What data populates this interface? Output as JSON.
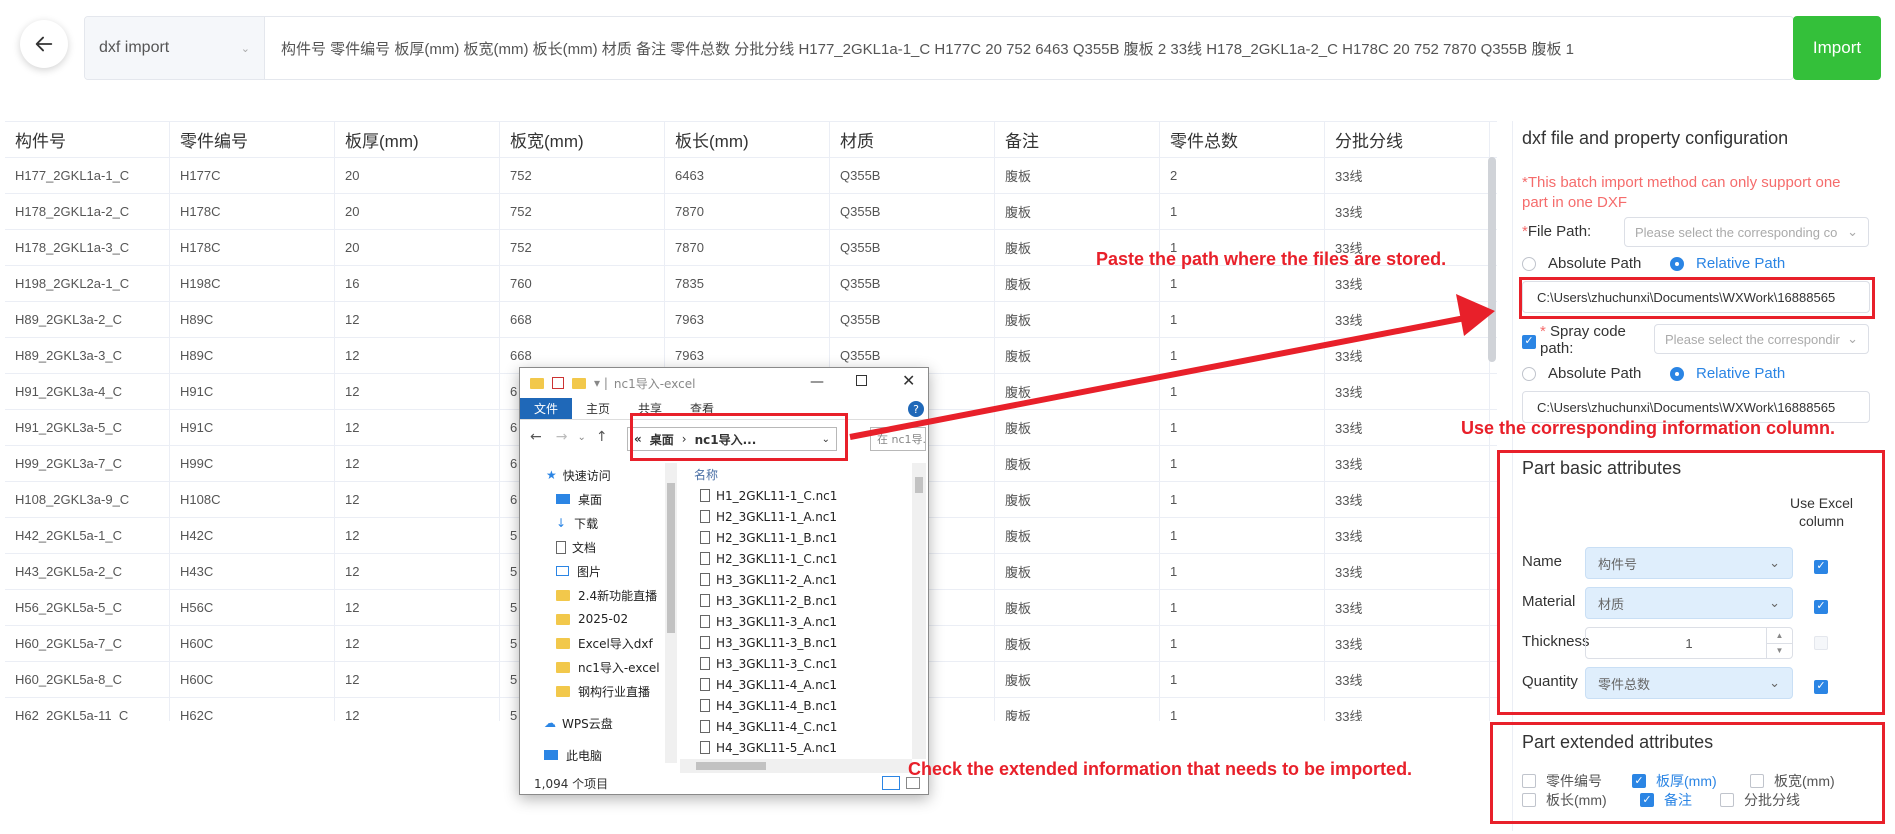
{
  "topbar": {
    "type_value": "dxf import",
    "paste_text": "构件号   零件编号  板厚(mm) 板宽(mm) 板长(mm) 材质  备注  零件总数   分批分线  H177_2GKL1a-1_C    H177C     20    752  6463        Q355B      腹板 2      33线  H178_2GKL1a-2_C   H178C     20    752  7870        Q355B      腹板 1",
    "import_label": "Import"
  },
  "table": {
    "headers": [
      "构件号",
      "零件编号",
      "板厚(mm)",
      "板宽(mm)",
      "板长(mm)",
      "材质",
      "备注",
      "零件总数",
      "分批分线"
    ],
    "rows": [
      [
        "H177_2GKL1a-1_C",
        "H177C",
        "20",
        "752",
        "6463",
        "Q355B",
        "腹板",
        "2",
        "33线"
      ],
      [
        "H178_2GKL1a-2_C",
        "H178C",
        "20",
        "752",
        "7870",
        "Q355B",
        "腹板",
        "1",
        "33线"
      ],
      [
        "H178_2GKL1a-3_C",
        "H178C",
        "20",
        "752",
        "7870",
        "Q355B",
        "腹板",
        "1",
        "33线"
      ],
      [
        "H198_2GKL2a-1_C",
        "H198C",
        "16",
        "760",
        "7835",
        "Q355B",
        "腹板",
        "1",
        "33线"
      ],
      [
        "H89_2GKL3a-2_C",
        "H89C",
        "12",
        "668",
        "7963",
        "Q355B",
        "腹板",
        "1",
        "33线"
      ],
      [
        "H89_2GKL3a-3_C",
        "H89C",
        "12",
        "668",
        "7963",
        "Q355B",
        "腹板",
        "1",
        "33线"
      ],
      [
        "H91_2GKL3a-4_C",
        "H91C",
        "12",
        "6",
        "",
        "",
        "腹板",
        "1",
        "33线"
      ],
      [
        "H91_2GKL3a-5_C",
        "H91C",
        "12",
        "6",
        "",
        "",
        "腹板",
        "1",
        "33线"
      ],
      [
        "H99_2GKL3a-7_C",
        "H99C",
        "12",
        "6",
        "",
        "",
        "腹板",
        "1",
        "33线"
      ],
      [
        "H108_2GKL3a-9_C",
        "H108C",
        "12",
        "6",
        "",
        "",
        "腹板",
        "1",
        "33线"
      ],
      [
        "H42_2GKL5a-1_C",
        "H42C",
        "12",
        "5",
        "",
        "",
        "腹板",
        "1",
        "33线"
      ],
      [
        "H43_2GKL5a-2_C",
        "H43C",
        "12",
        "5",
        "",
        "",
        "腹板",
        "1",
        "33线"
      ],
      [
        "H56_2GKL5a-5_C",
        "H56C",
        "12",
        "5",
        "",
        "",
        "腹板",
        "1",
        "33线"
      ],
      [
        "H60_2GKL5a-7_C",
        "H60C",
        "12",
        "5",
        "",
        "",
        "腹板",
        "1",
        "33线"
      ],
      [
        "H60_2GKL5a-8_C",
        "H60C",
        "12",
        "5",
        "",
        "",
        "腹板",
        "1",
        "33线"
      ],
      [
        "H62_2GKL5a-11_C",
        "H62C",
        "12",
        "5",
        "",
        "",
        "腹板",
        "1",
        "33线"
      ]
    ]
  },
  "panel": {
    "title": "dxf file and property configuration",
    "warning": "*This batch import method can only support one part in one DXF",
    "file_path_label": "File Path:",
    "file_path_select_placeholder": "Please select the corresponding co",
    "absolute_label": "Absolute Path",
    "relative_label": "Relative Path",
    "file_path_value": "C:\\Users\\zhuchunxi\\Documents\\WXWork\\16888565",
    "spray_label_1": "Spray code",
    "spray_label_2": "path:",
    "spray_select_placeholder": "Please select the correspondir",
    "spray_path_value": "C:\\Users\\zhuchunxi\\Documents\\WXWork\\16888565",
    "basic_title": "Part basic attributes",
    "use_excel_label_1": "Use Excel",
    "use_excel_label_2": "column",
    "name_label": "Name",
    "name_value": "构件号",
    "material_label": "Material",
    "material_value": "材质",
    "thickness_label": "Thickness",
    "thickness_value": "1",
    "quantity_label": "Quantity",
    "quantity_value": "零件总数",
    "extended_title": "Part extended attributes",
    "extended": [
      {
        "label": "零件编号",
        "checked": false
      },
      {
        "label": "板厚(mm)",
        "checked": true
      },
      {
        "label": "板宽(mm)",
        "checked": false
      },
      {
        "label": "板长(mm)",
        "checked": false
      },
      {
        "label": "备注",
        "checked": true
      },
      {
        "label": "分批分线",
        "checked": false
      }
    ]
  },
  "annotations": {
    "paste": "Paste the path where the files are stored.",
    "use_column": "Use the corresponding information column.",
    "check_ext": "Check the extended information that needs to be imported."
  },
  "explorer": {
    "title": "nc1导入-excel",
    "tabs": [
      "文件",
      "主页",
      "共享",
      "查看"
    ],
    "crumb_1": "«",
    "crumb_2": "桌面",
    "crumb_sep": "›",
    "crumb_3": "nc1导入...",
    "search_placeholder": "在 nc1导...",
    "column_header": "名称",
    "nav": [
      "快速访问",
      "桌面",
      "下载",
      "文档",
      "图片",
      "2.4新功能直播",
      "2025-02",
      "Excel导入dxf",
      "nc1导入-excel",
      "钢构行业直播",
      "WPS云盘",
      "此电脑"
    ],
    "files": [
      "H1_2GKL11-1_C.nc1",
      "H2_3GKL11-1_A.nc1",
      "H2_3GKL11-1_B.nc1",
      "H2_3GKL11-1_C.nc1",
      "H3_3GKL11-2_A.nc1",
      "H3_3GKL11-2_B.nc1",
      "H3_3GKL11-3_A.nc1",
      "H3_3GKL11-3_B.nc1",
      "H3_3GKL11-3_C.nc1",
      "H4_3GKL11-4_A.nc1",
      "H4_3GKL11-4_B.nc1",
      "H4_3GKL11-4_C.nc1",
      "H4_3GKL11-5_A.nc1"
    ],
    "status": "1,094 个项目"
  },
  "colors": {
    "accent": "#2b85e4",
    "import_green": "#34c03a",
    "annotation_red": "#e8202a",
    "warning": "#f56c6c"
  }
}
